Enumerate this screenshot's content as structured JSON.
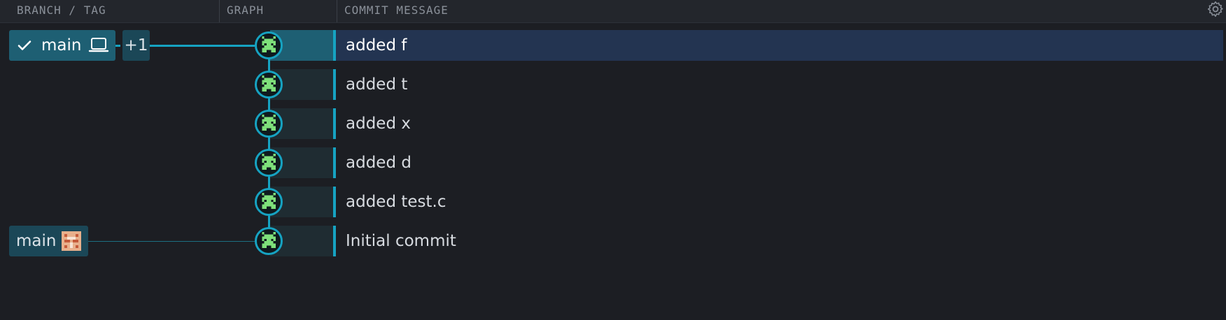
{
  "header": {
    "branch_tag_label": "BRANCH / TAG",
    "graph_label": "GRAPH",
    "commit_message_label": "COMMIT MESSAGE"
  },
  "refs": {
    "local_branch": {
      "name": "main",
      "overflow_count": "+1"
    },
    "remote_branch": {
      "name": "main"
    }
  },
  "commits": [
    {
      "message": "added f",
      "selected": true
    },
    {
      "message": "added t",
      "selected": false
    },
    {
      "message": "added x",
      "selected": false
    },
    {
      "message": "added d",
      "selected": false
    },
    {
      "message": "added test.c",
      "selected": false
    },
    {
      "message": "Initial commit",
      "selected": false
    }
  ],
  "colors": {
    "accent": "#16a3c2",
    "selected_row": "#233451",
    "background": "#1c1e23",
    "avatar_green": "#7ee07a"
  },
  "icons": [
    "checkmark-icon",
    "laptop-icon",
    "remote-avatar-icon",
    "settings-gear-icon",
    "commit-avatar-icon"
  ]
}
